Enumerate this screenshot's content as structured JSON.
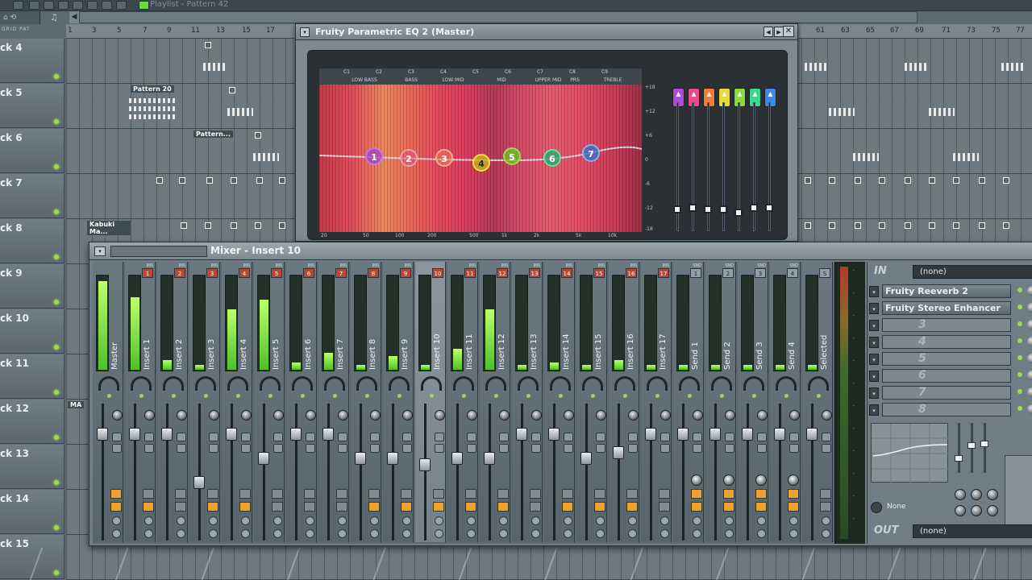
{
  "playlist": {
    "title": "Playlist - Pattern 42",
    "tool_label": "GRID PAT",
    "ruler_left": [
      "1",
      "3",
      "5",
      "7",
      "9",
      "11",
      "13",
      "15",
      "17"
    ],
    "ruler_right": [
      "61",
      "63",
      "65",
      "67",
      "69",
      "71",
      "73",
      "75",
      "77"
    ],
    "tracks": [
      "ck 4",
      "ck 5",
      "ck 6",
      "ck 7",
      "ck 8",
      "ck 9",
      "ck 10",
      "ck 11",
      "ck 12",
      "ck 13",
      "ck 14",
      "ck 15"
    ],
    "clip_labels": {
      "pattern20": "Pattern 20",
      "pattern_short": "Pattern...",
      "kabuki": "Kabuki Ma...",
      "ma": "MA"
    }
  },
  "eq": {
    "title": "Fruity Parametric EQ 2 (Master)",
    "band_codes": [
      "C1",
      "C2",
      "C3",
      "C4",
      "C5",
      "C6",
      "C7",
      "C8",
      "C9"
    ],
    "band_names": [
      "LOW BASS",
      "BASS",
      "LOW MID",
      "MID",
      "UPPER MID",
      "PRS",
      "TREBLE"
    ],
    "freq_axis": [
      "20",
      "50",
      "100",
      "200",
      "500",
      "1k",
      "2k",
      "5k",
      "10k"
    ],
    "db_axis": [
      "+18",
      "+12",
      "+6",
      "0",
      "-6",
      "-12",
      "-18"
    ],
    "nodes": [
      "1",
      "2",
      "3",
      "4",
      "5",
      "6",
      "7"
    ],
    "band_colors": [
      "#b04ad8",
      "#e84a8a",
      "#f07a3a",
      "#e8d83a",
      "#8ad83a",
      "#3ad88a",
      "#3a8ae8"
    ]
  },
  "mixer": {
    "title": "Mixer - Insert 10",
    "tracks": [
      {
        "name": "Master",
        "tag": "",
        "num": "",
        "level": 0.95,
        "fader": 0.2
      },
      {
        "name": "Insert 1",
        "tag": "INS",
        "num": "1",
        "level": 0.78,
        "fader": 0.2
      },
      {
        "name": "Insert 2",
        "tag": "INS",
        "num": "2",
        "level": 0.1,
        "fader": 0.2
      },
      {
        "name": "Insert 3",
        "tag": "INS",
        "num": "3",
        "level": 0.05,
        "fader": 0.6
      },
      {
        "name": "Insert 4",
        "tag": "INS",
        "num": "4",
        "level": 0.65,
        "fader": 0.2
      },
      {
        "name": "Insert 5",
        "tag": "INS",
        "num": "5",
        "level": 0.75,
        "fader": 0.4
      },
      {
        "name": "Insert 6",
        "tag": "INS",
        "num": "6",
        "level": 0.08,
        "fader": 0.2
      },
      {
        "name": "Insert 7",
        "tag": "INS",
        "num": "7",
        "level": 0.18,
        "fader": 0.2
      },
      {
        "name": "Insert 8",
        "tag": "INS",
        "num": "8",
        "level": 0.05,
        "fader": 0.4
      },
      {
        "name": "Insert 9",
        "tag": "INS",
        "num": "9",
        "level": 0.15,
        "fader": 0.4
      },
      {
        "name": "Insert 10",
        "tag": "",
        "num": "10",
        "level": 0.05,
        "fader": 0.45
      },
      {
        "name": "Insert 11",
        "tag": "INS",
        "num": "11",
        "level": 0.22,
        "fader": 0.4
      },
      {
        "name": "Insert 12",
        "tag": "INS",
        "num": "12",
        "level": 0.65,
        "fader": 0.4
      },
      {
        "name": "Insert 13",
        "tag": "INS",
        "num": "13",
        "level": 0.05,
        "fader": 0.2
      },
      {
        "name": "Insert 14",
        "tag": "INS",
        "num": "14",
        "level": 0.08,
        "fader": 0.2
      },
      {
        "name": "Insert 15",
        "tag": "INS",
        "num": "15",
        "level": 0.05,
        "fader": 0.4
      },
      {
        "name": "Insert 16",
        "tag": "INS",
        "num": "16",
        "level": 0.1,
        "fader": 0.35
      },
      {
        "name": "Insert 17",
        "tag": "INS",
        "num": "17",
        "level": 0.05,
        "fader": 0.2
      },
      {
        "name": "Send 1",
        "tag": "SND",
        "num": "1",
        "level": 0.05,
        "fader": 0.2
      },
      {
        "name": "Send 2",
        "tag": "SND",
        "num": "2",
        "level": 0.05,
        "fader": 0.2
      },
      {
        "name": "Send 3",
        "tag": "SND",
        "num": "3",
        "level": 0.05,
        "fader": 0.2
      },
      {
        "name": "Send 4",
        "tag": "SND",
        "num": "4",
        "level": 0.05,
        "fader": 0.2
      },
      {
        "name": "Selected",
        "tag": "",
        "num": "S",
        "level": 0.05,
        "fader": 0.2
      }
    ],
    "fx": {
      "in_label": "IN",
      "in_value": "(none)",
      "slots": [
        "Fruity Reeverb 2",
        "Fruity Stereo Enhancer",
        "3",
        "4",
        "5",
        "6",
        "7",
        "8"
      ],
      "eq_none_label": "None",
      "out_label": "OUT",
      "out_value": "(none)"
    }
  }
}
